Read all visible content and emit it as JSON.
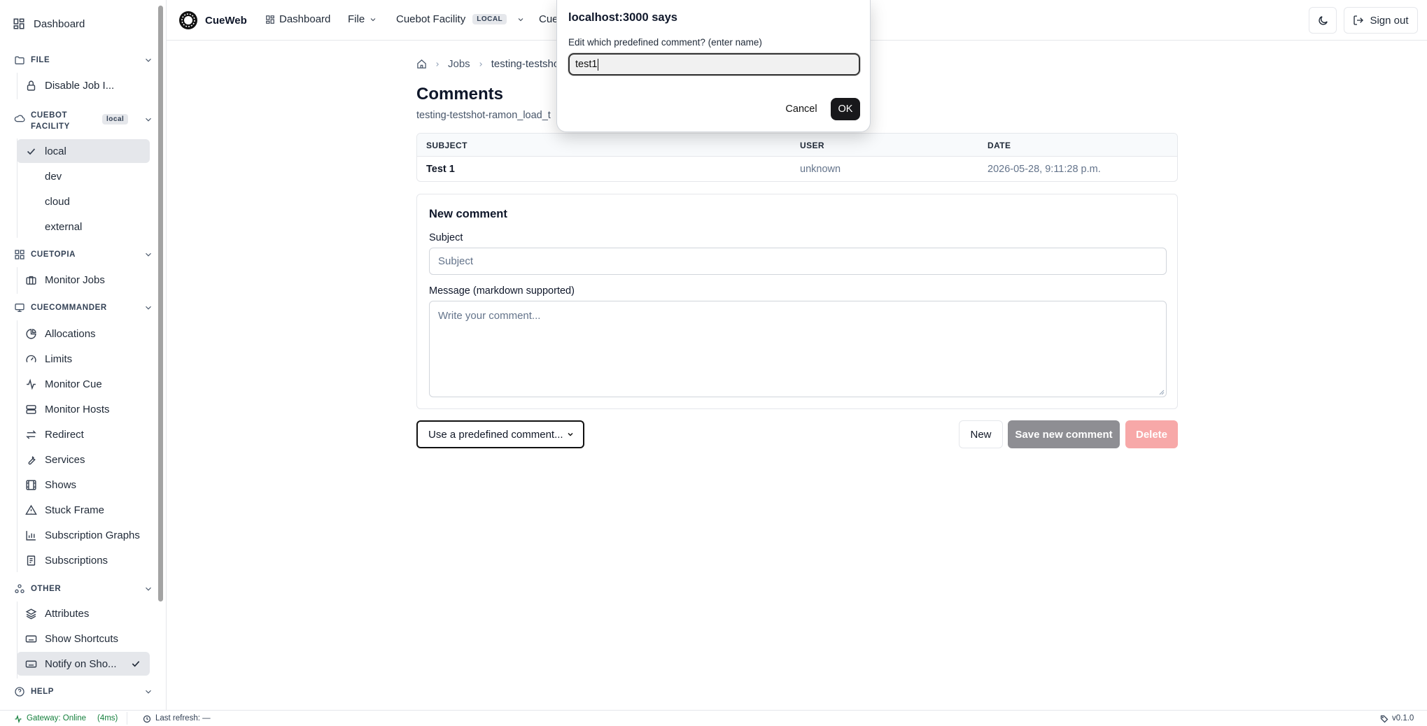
{
  "sidebar": {
    "dashboard": "Dashboard",
    "file_section": "FILE",
    "file_items": [
      "Disable Job I..."
    ],
    "facility_section": "CUEBOT FACILITY",
    "facility_badge": "local",
    "facility_items": [
      "local",
      "dev",
      "cloud",
      "external"
    ],
    "cuetopia_section": "CUETOPIA",
    "cuetopia_items": [
      "Monitor Jobs"
    ],
    "cuecommander_section": "CUECOMMANDER",
    "cuecommander_items": [
      "Allocations",
      "Limits",
      "Monitor Cue",
      "Monitor Hosts",
      "Redirect",
      "Services",
      "Shows",
      "Stuck Frame",
      "Subscription Graphs",
      "Subscriptions"
    ],
    "other_section": "OTHER",
    "other_items": [
      "Attributes",
      "Show Shortcuts",
      "Notify on Sho..."
    ],
    "help_section": "HELP"
  },
  "topbar": {
    "app_name": "CueWeb",
    "dashboard": "Dashboard",
    "file": "File",
    "facility": "Cuebot Facility",
    "facility_badge": "LOCAL",
    "cue_partial": "Cue",
    "sign_out": "Sign out"
  },
  "breadcrumb": {
    "jobs": "Jobs",
    "job": "testing-testshot-"
  },
  "page": {
    "title": "Comments",
    "subtitle": "testing-testshot-ramon_load_t"
  },
  "table": {
    "headers": [
      "SUBJECT",
      "USER",
      "DATE"
    ],
    "rows": [
      {
        "subject": "Test 1",
        "user": "unknown",
        "date": "2026-05-28, 9:11:28 p.m."
      }
    ]
  },
  "new_comment": {
    "heading": "New comment",
    "subject_label": "Subject",
    "subject_placeholder": "Subject",
    "message_label": "Message (markdown supported)",
    "message_placeholder": "Write your comment..."
  },
  "actions": {
    "predefined_select": "Use a predefined comment...",
    "new": "New",
    "save": "Save new comment",
    "delete": "Delete"
  },
  "dialog": {
    "title": "localhost:3000 says",
    "prompt": "Edit which predefined comment? (enter name)",
    "value": "test1",
    "cancel": "Cancel",
    "ok": "OK"
  },
  "status": {
    "gateway": "Gateway: Online",
    "latency": "(4ms)",
    "last_refresh": "Last refresh: —",
    "version": "v0.1.0"
  },
  "colors": {
    "accent": "#18181b",
    "save_bg": "#8e8e93",
    "delete_bg": "#f7a8a8",
    "status_green": "#15803d"
  }
}
